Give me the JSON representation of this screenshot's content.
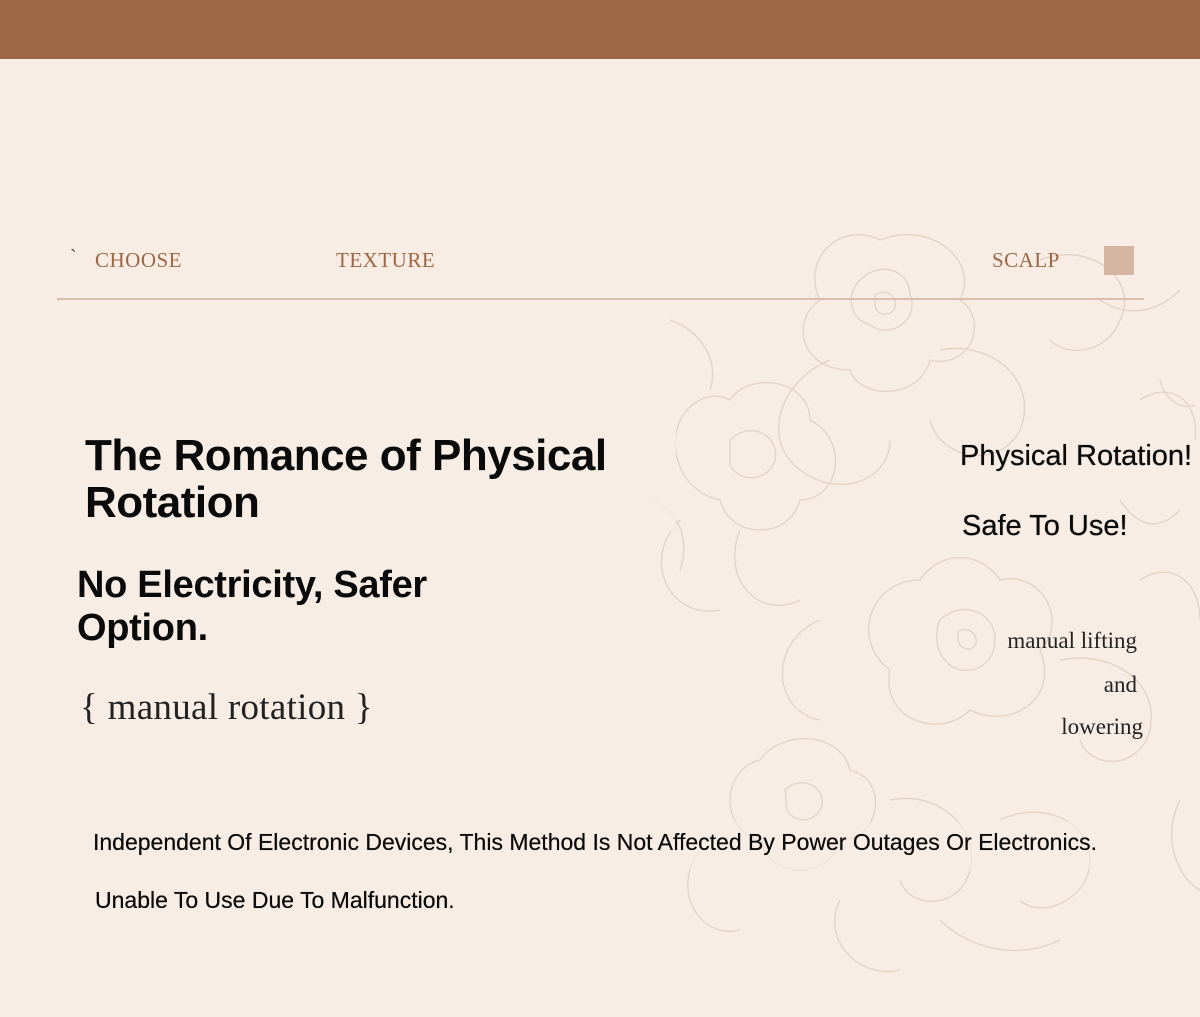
{
  "nav": {
    "tick": "`",
    "items": [
      {
        "label": "CHOOSE"
      },
      {
        "label": "TEXTURE"
      },
      {
        "label": "SCALP"
      }
    ]
  },
  "main": {
    "title": "The Romance of Physical Rotation",
    "subtitle": "No Electricity, Safer Option.",
    "tagline": "{ manual rotation }"
  },
  "side": {
    "heading_1": "Physical Rotation!",
    "heading_2": "Safe To Use!",
    "serif_lines": [
      "manual lifting",
      "and",
      "lowering"
    ]
  },
  "body": {
    "line_1": "Independent Of Electronic Devices, This Method Is Not Affected By Power Outages Or Electronics.",
    "line_2": "Unable To Use Due To Malfunction."
  },
  "colors": {
    "header_bar": "#9d6745",
    "background": "#f7ede4",
    "nav_text": "#9d6745",
    "swatch": "#d4b6a3",
    "divider": "#d9beab"
  }
}
